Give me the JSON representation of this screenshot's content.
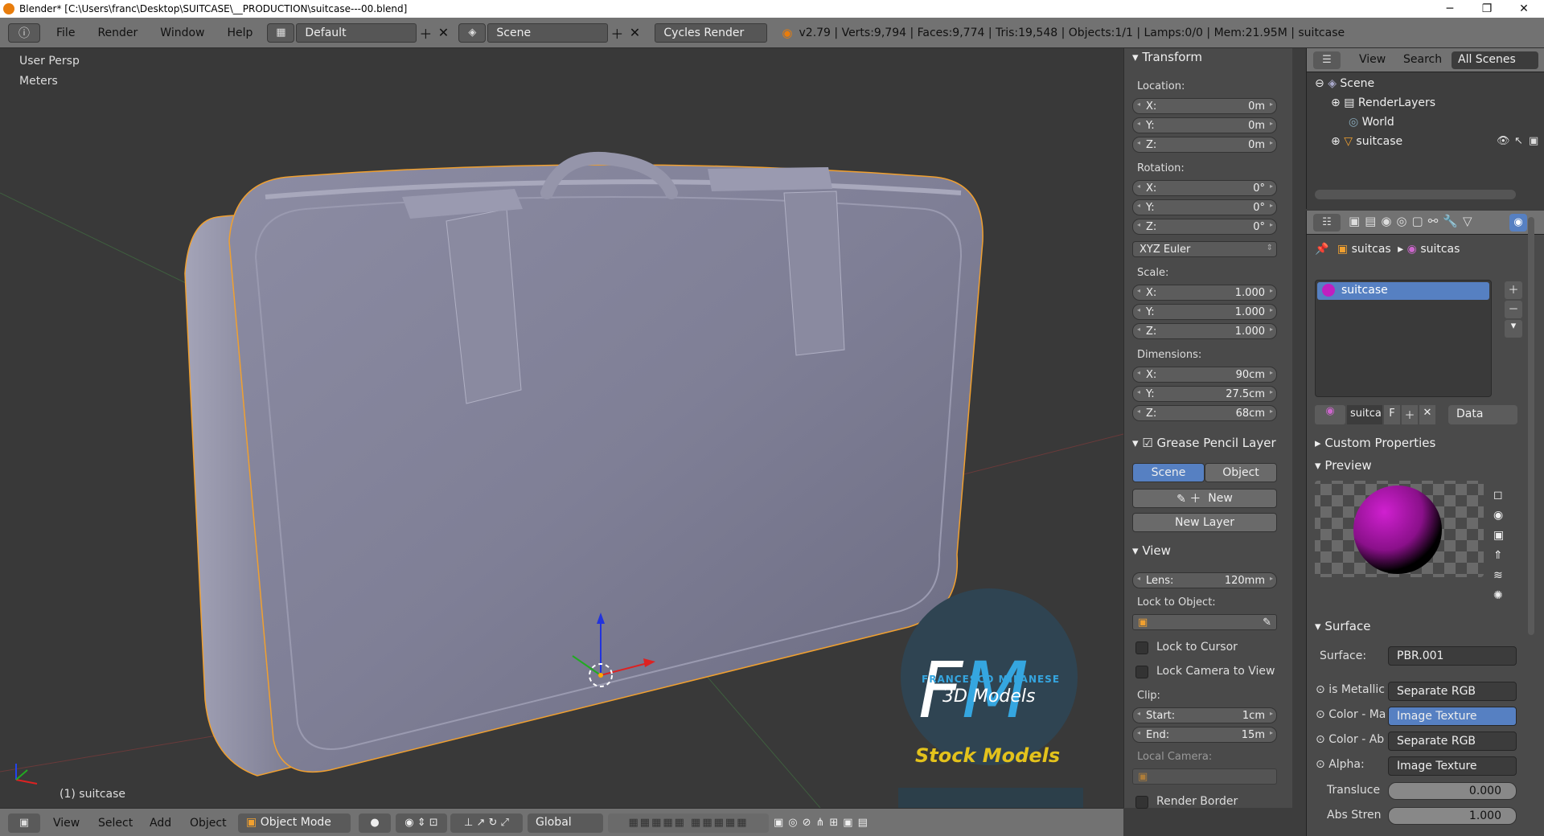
{
  "window": {
    "title": "Blender* [C:\\Users\\franc\\Desktop\\SUITCASE\\__PRODUCTION\\suitcase---00.blend]",
    "minimize": "─",
    "maximize": "❐",
    "close": "✕"
  },
  "topbar": {
    "menus": [
      "File",
      "Render",
      "Window",
      "Help"
    ],
    "layout": "Default",
    "scene": "Scene",
    "engine": "Cycles Render",
    "stats": "v2.79 | Verts:9,794 | Faces:9,774 | Tris:19,548 | Objects:1/1 | Lamps:0/0 | Mem:21.95M | suitcase"
  },
  "viewport": {
    "view_name": "User Persp",
    "units": "Meters",
    "object_label": "(1) suitcase",
    "watermark": {
      "initials": "FM",
      "name": "FRANCESCO MILANESE",
      "sub": "3D Models",
      "banner": "Stock Models"
    }
  },
  "npanel": {
    "transform_header": "Transform",
    "location_label": "Location:",
    "location": [
      {
        "axis": "X:",
        "value": "0m"
      },
      {
        "axis": "Y:",
        "value": "0m"
      },
      {
        "axis": "Z:",
        "value": "0m"
      }
    ],
    "rotation_label": "Rotation:",
    "rotation": [
      {
        "axis": "X:",
        "value": "0°"
      },
      {
        "axis": "Y:",
        "value": "0°"
      },
      {
        "axis": "Z:",
        "value": "0°"
      }
    ],
    "rotation_mode": "XYZ Euler",
    "scale_label": "Scale:",
    "scale": [
      {
        "axis": "X:",
        "value": "1.000"
      },
      {
        "axis": "Y:",
        "value": "1.000"
      },
      {
        "axis": "Z:",
        "value": "1.000"
      }
    ],
    "dimensions_label": "Dimensions:",
    "dimensions": [
      {
        "axis": "X:",
        "value": "90cm"
      },
      {
        "axis": "Y:",
        "value": "27.5cm"
      },
      {
        "axis": "Z:",
        "value": "68cm"
      }
    ],
    "gp_header": "Grease Pencil Layer",
    "gp_tab_scene": "Scene",
    "gp_tab_object": "Object",
    "gp_new": "New",
    "gp_new_layer": "New Layer",
    "view_header": "View",
    "lens_label": "Lens:",
    "lens_value": "120mm",
    "lock_to_object": "Lock to Object:",
    "lock_to_cursor": "Lock to Cursor",
    "lock_camera": "Lock Camera to View",
    "clip_label": "Clip:",
    "clip_start_label": "Start:",
    "clip_start": "1cm",
    "clip_end_label": "End:",
    "clip_end": "15m",
    "local_camera": "Local Camera:",
    "render_border": "Render Border"
  },
  "outliner": {
    "view": "View",
    "search": "Search",
    "filter": "All Scenes",
    "items": [
      "Scene",
      "RenderLayers",
      "World",
      "suitcase"
    ]
  },
  "properties": {
    "breadcrumb_1": "suitcas",
    "breadcrumb_2": "suitcas",
    "material_slot": "suitcase",
    "material_name": "suitca",
    "fake_user": "F",
    "link": "Data",
    "custom_props": "Custom Properties",
    "preview": "Preview",
    "surface_header": "Surface",
    "surface_label": "Surface:",
    "surface_value": "PBR.001",
    "rows": [
      {
        "label": "is Metallic",
        "value": "Separate RGB"
      },
      {
        "label": "Color - Ma",
        "value": "Image Texture"
      },
      {
        "label": "Color - Ab",
        "value": "Separate RGB"
      },
      {
        "label": "Alpha:",
        "value": "Image Texture"
      }
    ],
    "translucency_label": "Transluce",
    "translucency_value": "0.000",
    "abs_label": "Abs Stren",
    "abs_value": "1.000"
  },
  "bottombar": {
    "menus": [
      "View",
      "Select",
      "Add",
      "Object"
    ],
    "mode": "Object Mode",
    "orientation": "Global"
  },
  "colors": {
    "accent_blue": "#5680c2",
    "selected_orange": "#f0a030",
    "material_purple": "#c020c0"
  }
}
